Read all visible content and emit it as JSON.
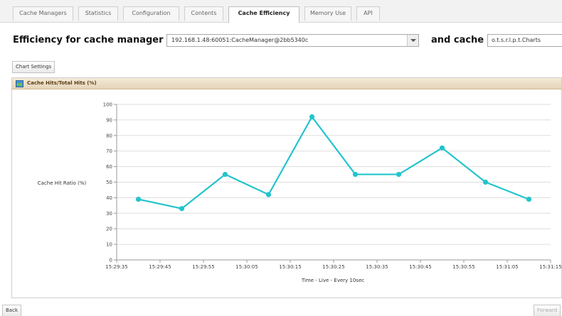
{
  "tabs": [
    {
      "label": "Cache Managers",
      "active": false
    },
    {
      "label": "Statistics",
      "active": false
    },
    {
      "label": "Configuration",
      "active": false
    },
    {
      "label": "Contents",
      "active": false
    },
    {
      "label": "Cache Efficiency",
      "active": true
    },
    {
      "label": "Memory Use",
      "active": false
    },
    {
      "label": "API",
      "active": false
    }
  ],
  "header": {
    "efficiency_label": "Efficiency for cache manager",
    "cache_manager_value": "192.168.1.48:60051:CacheManager@2bb5340c",
    "and_cache_label": "and cache",
    "cache_value": "o.t.s.r.l.p.t.Charts"
  },
  "buttons": {
    "chart_settings": "Chart Settings",
    "back": "Back",
    "forward": "Forward"
  },
  "panel": {
    "title": "Cache Hits/Total Hits (%)",
    "icon": "chart-icon"
  },
  "colors": {
    "series": "#22c4cc",
    "grid": "#dddddd",
    "axis": "#999999"
  },
  "chart_data": {
    "type": "line",
    "title": "Cache Hits/Total Hits (%)",
    "xlabel": "Time - Live - Every 10sec",
    "ylabel": "Cache Hit Ratio (%)",
    "ylim": [
      0,
      100
    ],
    "yticks": [
      0,
      10,
      20,
      30,
      40,
      50,
      60,
      70,
      80,
      90,
      100
    ],
    "xticks": [
      "15:29:35",
      "15:29:45",
      "15:29:55",
      "15:30:05",
      "15:30:15",
      "15:30:25",
      "15:30:35",
      "15:30:45",
      "15:30:55",
      "15:31:05",
      "15:31:15"
    ],
    "grid": true,
    "series": [
      {
        "x": [
          "15:29:40",
          "15:29:50",
          "15:30:00",
          "15:30:10",
          "15:30:20",
          "15:30:30",
          "15:30:40",
          "15:30:50",
          "15:31:00",
          "15:31:10"
        ],
        "values": [
          39,
          33,
          55,
          42,
          92,
          55,
          55,
          72,
          50,
          39
        ]
      }
    ]
  }
}
